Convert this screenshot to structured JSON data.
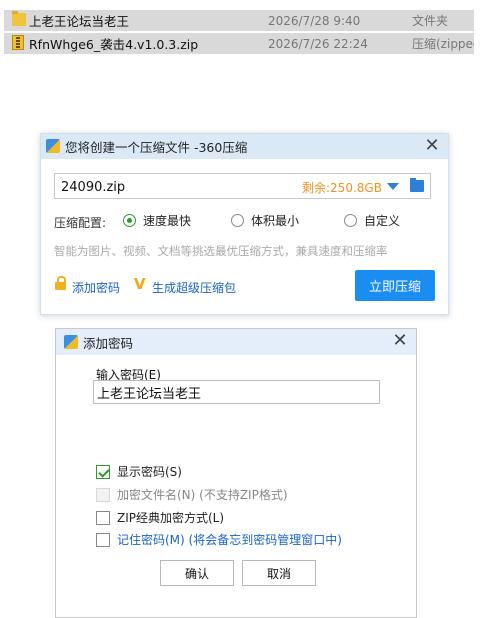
{
  "files": [
    {
      "name": "上老王论坛当老王",
      "date": "2026/7/28 9:40",
      "type": "文件夹",
      "icon": "folder-icon"
    },
    {
      "name": "RfnWhge6_袭击4.v1.0.3.zip",
      "date": "2026/7/26 22:24",
      "type": "压缩(zipped)",
      "icon": "zip-icon"
    }
  ],
  "compress_dialog": {
    "title": "您将创建一个压缩文件 -360压缩",
    "filename": "24090.zip",
    "free_space": "剩余:250.8GB",
    "config_label": "压缩配置:",
    "options": [
      "速度最快",
      "体积最小",
      "自定义"
    ],
    "selected_option": "速度最快",
    "hint": "智能为图片、视频、文档等挑选最优压缩方式，兼具速度和压缩率",
    "add_password": "添加密码",
    "super_package": "生成超级压缩包",
    "compress_button": "立即压缩"
  },
  "password_dialog": {
    "title": "添加密码",
    "input_label": "输入密码(E)",
    "password_value": "上老王论坛当老王",
    "show_password": "显示密码(S)",
    "encrypt_names": "加密文件名(N) (不支持ZIP格式)",
    "zip_classic": "ZIP经典加密方式(L)",
    "remember": "记住密码(M) (将会备忘到密码管理窗口中)",
    "ok": "确认",
    "cancel": "取消"
  },
  "colors": {
    "accent": "#1a8ef0",
    "link": "#1a63c4",
    "free_space": "#f0931e",
    "check_green": "#2d9a2d"
  }
}
